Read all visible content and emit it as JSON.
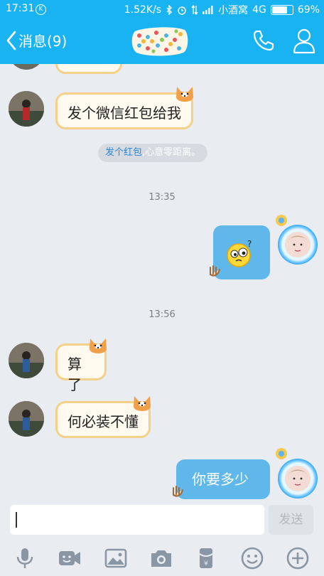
{
  "status_bar": {
    "time": "17:31",
    "k_badge": "K",
    "network_speed": "1.52K/s",
    "carrier": "小酒窝",
    "network_type": "4G",
    "battery_percent": "69%",
    "battery_level": 0.69
  },
  "header": {
    "back_label": "消息(9)"
  },
  "messages": {
    "msg1_text": "发个微信红包给我",
    "system_link": "发个红包",
    "system_rest": ",心意零距离。",
    "time1": "13:35",
    "time2": "13:56",
    "msg2_text": "算了",
    "msg3_text": "何必装不懂",
    "msg4_text": "你要多少"
  },
  "input": {
    "placeholder": "",
    "send_label": "发送"
  },
  "toolbar": {
    "items": [
      "microphone-icon",
      "video-emoji-icon",
      "image-icon",
      "camera-icon",
      "red-packet-icon",
      "emoji-icon",
      "plus-icon"
    ]
  },
  "colors": {
    "header_bg": "#19b3f2",
    "outgoing_bubble": "#5fb7ea",
    "incoming_bubble_border": "#f5d089",
    "link_blue": "#2e86d6"
  }
}
